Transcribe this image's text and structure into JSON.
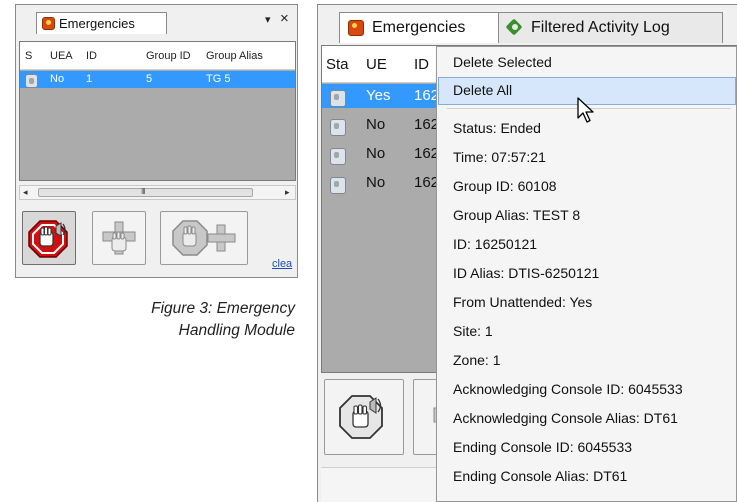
{
  "left_panel": {
    "tab_label": "Emergencies",
    "pin_glyph": "▾",
    "close_glyph": "×",
    "columns": [
      "S",
      "UEA",
      "ID",
      "Group ID",
      "Group Alias"
    ],
    "row": {
      "uea": "No",
      "id": "1",
      "group_id": "5",
      "group_alias": "TG 5"
    },
    "clear_link": "clea",
    "scroll_grip": "III"
  },
  "caption": {
    "line1": "Figure 3:  Emergency",
    "line2": "Handling Module"
  },
  "right_panel": {
    "tabs": [
      "Emergencies",
      "Filtered Activity Log"
    ],
    "columns": [
      "Sta",
      "UE",
      "ID"
    ],
    "rows": [
      {
        "ue": "Yes",
        "id": "162",
        "selected": true
      },
      {
        "ue": "No",
        "id": "162",
        "selected": false
      },
      {
        "ue": "No",
        "id": "162",
        "selected": false
      },
      {
        "ue": "No",
        "id": "162",
        "selected": false
      }
    ]
  },
  "context_menu": {
    "actions": [
      "Delete Selected",
      "Delete All"
    ],
    "details": [
      "Status: Ended",
      "Time: 07:57:21",
      "Group ID: 60108",
      "Group Alias: TEST 8",
      "ID: 16250121",
      "ID Alias: DTIS-6250121",
      "From Unattended: Yes",
      "Site: 1",
      "Zone: 1",
      "Acknowledging Console ID: 6045533",
      "Acknowledging Console Alias: DT61",
      "Ending Console ID: 6045533",
      "Ending Console Alias: DT61"
    ]
  },
  "colors": {
    "selection": "#3399ff",
    "menu_highlight": "#d6e7fb",
    "emergency_red": "#d01010"
  },
  "icons": [
    "siren-icon",
    "activity-log-icon",
    "emergency-hand-icon",
    "add-hand-icon",
    "acknowledge-hand-icon",
    "pointer-cursor-icon"
  ]
}
